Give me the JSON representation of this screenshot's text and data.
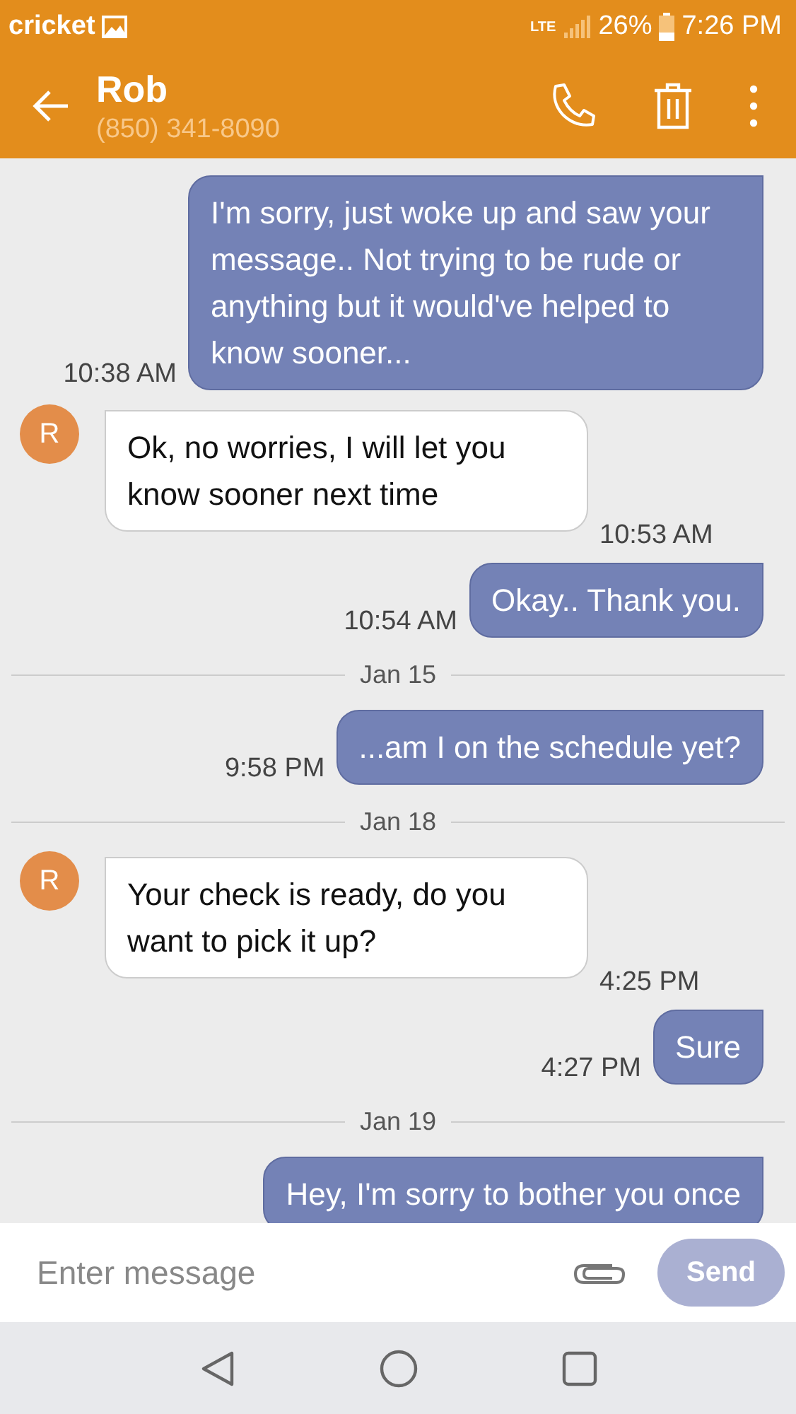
{
  "status_bar": {
    "carrier": "cricket",
    "network": "LTE",
    "battery": "26%",
    "time": "7:26 PM"
  },
  "header": {
    "name": "Rob",
    "phone": "(850) 341-8090"
  },
  "messages": [
    {
      "kind": "sent",
      "text": "I'm sorry, just woke up and saw your message.. Not trying to be rude or anything but it would've helped to know sooner...",
      "time": "10:38 AM"
    },
    {
      "kind": "received",
      "avatar": "R",
      "text": "Ok, no worries, I will let you know sooner next time",
      "time": "10:53 AM"
    },
    {
      "kind": "sent",
      "text": "Okay.. Thank you.",
      "time": "10:54 AM"
    },
    {
      "kind": "date",
      "text": "Jan 15"
    },
    {
      "kind": "sent",
      "text": "...am I on the schedule yet?",
      "time": "9:58 PM"
    },
    {
      "kind": "date",
      "text": "Jan 18"
    },
    {
      "kind": "received",
      "avatar": "R",
      "text": "Your check is ready, do you want to pick it up?",
      "time": "4:25 PM"
    },
    {
      "kind": "sent",
      "text": "Sure",
      "time": "4:27 PM"
    },
    {
      "kind": "date",
      "text": "Jan 19"
    },
    {
      "kind": "sent",
      "text": "Hey, I'm sorry to bother you once"
    }
  ],
  "composer": {
    "placeholder": "Enter message",
    "send": "Send",
    "send_disabled": true
  }
}
